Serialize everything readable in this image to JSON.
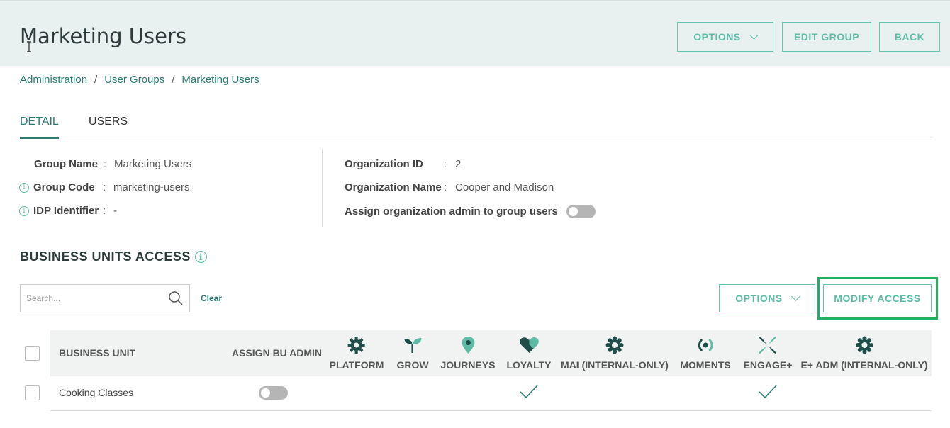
{
  "header": {
    "title": "Marketing Users",
    "options_label": "OPTIONS",
    "edit_group_label": "EDIT GROUP",
    "back_label": "BACK"
  },
  "breadcrumb": [
    "Administration",
    "User Groups",
    "Marketing Users"
  ],
  "tabs": [
    {
      "label": "DETAIL",
      "active": true
    },
    {
      "label": "USERS",
      "active": false
    }
  ],
  "details": {
    "group_name": {
      "label": "Group Name",
      "value": "Marketing Users"
    },
    "group_code": {
      "label": "Group Code",
      "value": "marketing-users"
    },
    "idp_identifier": {
      "label": "IDP Identifier",
      "value": "-"
    },
    "organization_id": {
      "label": "Organization ID",
      "value": "2"
    },
    "organization_name": {
      "label": "Organization Name",
      "value": "Cooper and Madison"
    },
    "assign_org_admin": {
      "label": "Assign organization admin to group users",
      "value": false
    },
    "colon": ":"
  },
  "business_units": {
    "title": "BUSINESS UNITS ACCESS",
    "search_placeholder": "Search...",
    "clear_label": "Clear",
    "options_label": "OPTIONS",
    "modify_access_label": "MODIFY ACCESS",
    "columns": {
      "business_unit": "BUSINESS UNIT",
      "assign_bu_admin": "ASSIGN BU ADMIN",
      "products": [
        "PLATFORM",
        "GROW",
        "JOURNEYS",
        "LOYALTY",
        "MAI (INTERNAL-ONLY)",
        "MOMENTS",
        "ENGAGE+",
        "E+ ADM (INTERNAL-ONLY)"
      ]
    },
    "rows": [
      {
        "name": "Cooking Classes",
        "assign_bu_admin": false,
        "access": {
          "LOYALTY": true,
          "ENGAGE+": true
        }
      }
    ]
  },
  "colors": {
    "accent": "#5ebca6",
    "link": "#2b7d73",
    "icon_dark": "#1f4e4a",
    "highlight": "#22b05e"
  },
  "icons": {
    "info": "i",
    "platform": "gear-icon",
    "grow": "sprout-icon",
    "journeys": "map-pin-icon",
    "loyalty": "heart-tag-icon",
    "mai": "gear-icon",
    "moments": "broadcast-icon",
    "engage": "leaf-star-icon",
    "eplus_adm": "gear-icon"
  }
}
